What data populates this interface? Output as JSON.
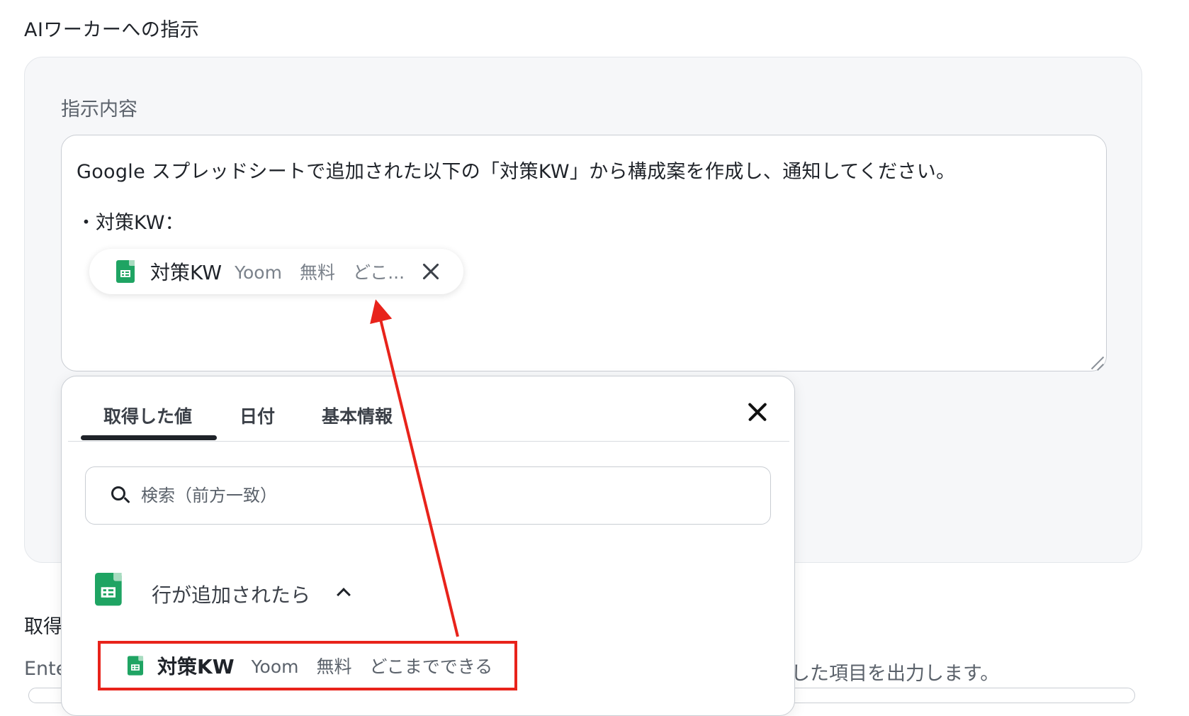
{
  "section": {
    "title": "AIワーカーへの指示"
  },
  "instruction": {
    "label": "指示内容",
    "line1": "Google スプレッドシートで追加された以下の「対策KW」から構成案を作成し、通知してください。",
    "line2": "・対策KW：",
    "chip": {
      "icon": "google-sheets-icon",
      "name": "対策KW",
      "meta": "Yoom　無料　どこ..."
    }
  },
  "background": {
    "label_fragment": "取得",
    "desc_left_fragment": "Ente",
    "desc_right_fragment": "した項目を出力します。"
  },
  "popup": {
    "tabs": [
      {
        "label": "取得した値",
        "active": true
      },
      {
        "label": "日付"
      },
      {
        "label": "基本情報"
      }
    ],
    "search": {
      "placeholder": "検索（前方一致）"
    },
    "group": {
      "icon": "google-sheets-icon",
      "label": "行が追加されたら",
      "expanded": true
    },
    "item": {
      "icon": "google-sheets-icon",
      "name": "対策KW",
      "meta": "Yoom　無料　どこまでできる"
    }
  },
  "annotation": {
    "color": "#e8231b"
  },
  "colors": {
    "sheets_green": "#1fa463",
    "panel_bg": "#f6f7f9"
  }
}
